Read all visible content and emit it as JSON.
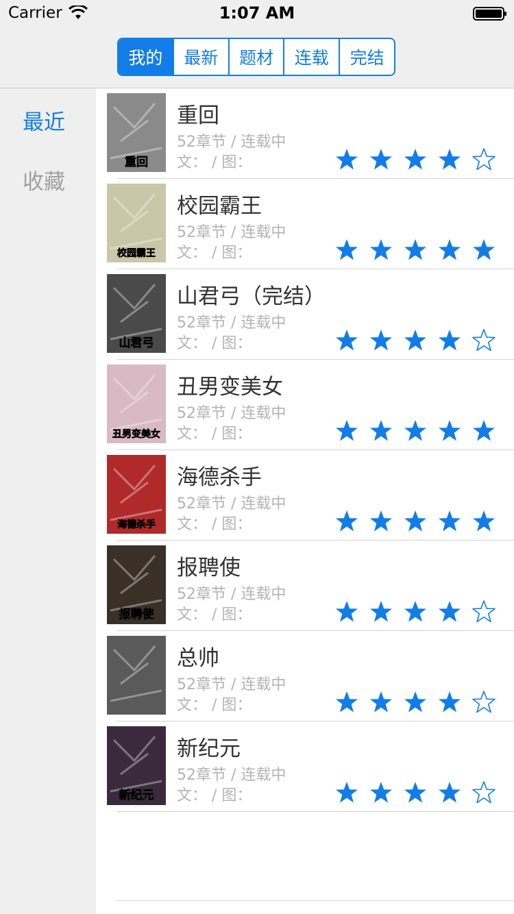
{
  "status_bar": {
    "carrier": "Carrier",
    "time": "1:07 AM"
  },
  "nav": {
    "segments": [
      {
        "label": "我的",
        "active": true
      },
      {
        "label": "最新",
        "active": false
      },
      {
        "label": "题材",
        "active": false
      },
      {
        "label": "连载",
        "active": false
      },
      {
        "label": "完结",
        "active": false
      }
    ]
  },
  "sidebar": {
    "items": [
      {
        "label": "最近",
        "active": true
      },
      {
        "label": "收藏",
        "active": false
      }
    ]
  },
  "list": {
    "items": [
      {
        "title": "重回",
        "meta": "52章节 / 连载中",
        "credits": "文： / 图：",
        "rating": 4,
        "cover_text": "重回",
        "cover_bg": "#8a8a8a"
      },
      {
        "title": "校园霸王",
        "meta": "52章节 / 连载中",
        "credits": "文： / 图：",
        "rating": 5,
        "cover_text": "校园霸王",
        "cover_bg": "#c9c7a8"
      },
      {
        "title": "山君弓（完结）",
        "meta": "52章节 / 连载中",
        "credits": "文： / 图：",
        "rating": 4,
        "cover_text": "山君弓",
        "cover_bg": "#4a4a4a"
      },
      {
        "title": "丑男变美女",
        "meta": "52章节 / 连载中",
        "credits": "文： / 图：",
        "rating": 5,
        "cover_text": "丑男变美女",
        "cover_bg": "#d9b9c4"
      },
      {
        "title": "海德杀手",
        "meta": "52章节 / 连载中",
        "credits": "文： / 图：",
        "rating": 5,
        "cover_text": "海德杀手",
        "cover_bg": "#b02a2a"
      },
      {
        "title": "报聘使",
        "meta": "52章节 / 连载中",
        "credits": "文： / 图：",
        "rating": 4,
        "cover_text": "报聘使",
        "cover_bg": "#3a3028"
      },
      {
        "title": "总帅",
        "meta": "52章节 / 连载中",
        "credits": "文： / 图：",
        "rating": 4,
        "cover_text": "",
        "cover_bg": "#5a5a5a"
      },
      {
        "title": "新纪元",
        "meta": "52章节 / 连载中",
        "credits": "文： / 图：",
        "rating": 4,
        "cover_text": "新纪元",
        "cover_bg": "#3b2a3e"
      }
    ],
    "max_rating": 5
  },
  "colors": {
    "accent": "#127de6",
    "muted_text": "#b3b3b3",
    "title_text": "#333333",
    "sidebar_bg": "#efefef"
  }
}
